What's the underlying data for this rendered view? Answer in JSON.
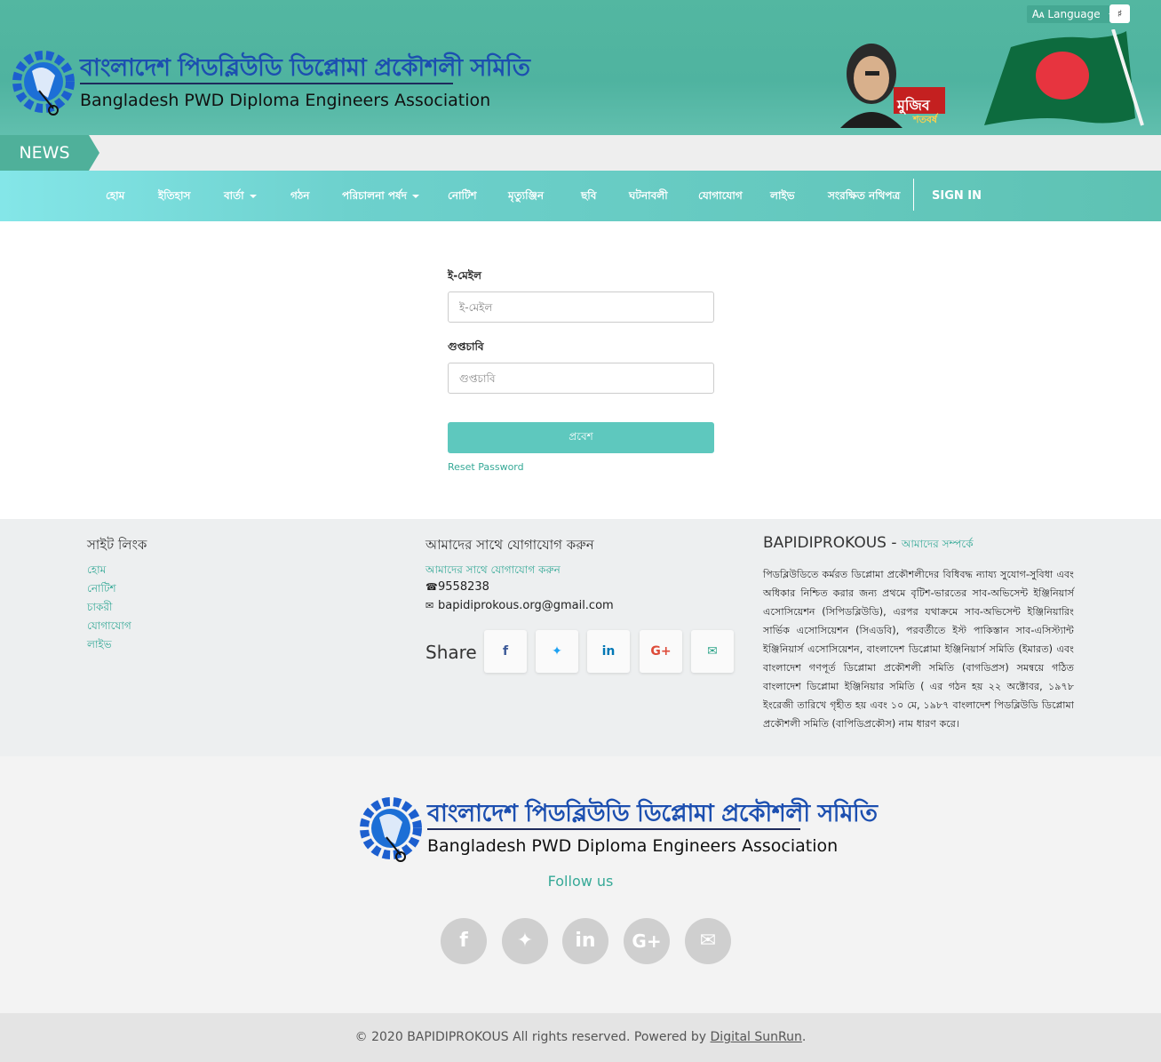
{
  "header": {
    "org_name_bn": "বাংলাদেশ পিডব্লিউডি ডিপ্লোমা প্রকৌশলী সমিতি",
    "org_name_en": "Bangladesh PWD Diploma Engineers Association",
    "language_label": "Language",
    "mujib_text": "মুজিব",
    "mujib_year": "শতবর্ষ"
  },
  "news": {
    "label": "NEWS"
  },
  "nav": {
    "items": [
      {
        "label": "হোম"
      },
      {
        "label": "ইতিহাস"
      },
      {
        "label": "বার্তা"
      },
      {
        "label": "গঠন"
      },
      {
        "label": "পরিচালনা পর্ষদ"
      },
      {
        "label": "নোটিশ"
      },
      {
        "label": "মৃত্যুঞ্জিন"
      },
      {
        "label": "ছবি"
      },
      {
        "label": "ঘটনাবলী"
      },
      {
        "label": "যোগাযোগ"
      },
      {
        "label": "লাইভ"
      },
      {
        "label": "সংরক্ষিত নথিপত্র"
      }
    ],
    "sign_in": "SIGN IN"
  },
  "login": {
    "email_label": "ই-মেইল",
    "email_placeholder": "ই-মেইল",
    "password_label": "গুপ্তচাবি",
    "password_placeholder": "গুপ্তচাবি",
    "submit_label": "প্রবেশ",
    "reset_label": "Reset Password"
  },
  "footer": {
    "site_links_title": "সাইট লিংক",
    "site_links": [
      "হোম",
      "নোটিশ",
      "চাকরী",
      "যোগাযোগ",
      "লাইভ"
    ],
    "contact_title": "আমাদের সাথে যোগাযোগ করুন",
    "contact_link": "আমাদের সাথে যোগাযোগ করুন",
    "phone": "9558238",
    "email": "bapidiprokous.org@gmail.com",
    "share_label": "Share",
    "about_title": "BAPIDIPROKOUS",
    "about_sep": " - ",
    "about_sub": "আমাদের সম্পর্কে",
    "about_body": "পিডব্লিউডিতে কর্মরত ডিপ্লোমা প্রকৌশলীদের বিধিবদ্ধ ন্যায্য সুযোগ-সুবিধা এবং অধিকার নিশ্চিত করার জন্য প্রথমে বৃটিশ-ভারতের সাব-অভিসেন্ট ইঞ্জিনিয়ার্স এসোসিয়েশন (সিপিডব্লিউডি), এরপর যথাক্রমে সাব-অভিসেন্ট ইঞ্জিনিয়ারিং সার্ভিক এসোসিয়েশন (সিএডবি), পরবর্তীতে ইস্ট পাকিস্তান সাব-এসিস্ট্যান্ট ইঞ্জিনিয়ার্স এসোসিয়েশন, বাংলাদেশ ডিপ্লোমা ইঞ্জিনিয়ার্স সমিতি (ইমারত) এবং বাংলাদেশ গণপূর্ত ডিপ্লোমা প্রকৌশলী সমিতি (বাগডিপ্রস) সমন্বয়ে গঠিত বাংলাদেশ ডিপ্লোমা ইঞ্জিনিয়ার সমিতি ( এর গঠন হয় ২২ অক্টোবর, ১৯৭৮ ইংরেজী তারিখে গৃহীত হয় এবং ১০ মে, ১৯৮৭ বাংলাদেশ পিডব্লিউডি ডিপ্লোমা প্রকৌশলী সমিতি (বাপিডিপ্রকৌস) নাম ধারণ করে।",
    "bottom_org_bn": "বাংলাদেশ পিডব্লিউডি ডিপ্লোমা প্রকৌশলী সমিতি",
    "bottom_org_en": "Bangladesh PWD Diploma Engineers Association",
    "follow_us": "Follow us",
    "copyright_prefix": "© 2020 BAPIDIPROKOUS All rights reserved. Powered by ",
    "copyright_link": "Digital SunRun",
    "copyright_suffix": "."
  },
  "colors": {
    "brand_teal": "#4fb3a0",
    "accent_link": "#36a997",
    "logo_blue": "#1c4fb0",
    "button": "#5ec8be"
  },
  "icons": {
    "share": [
      "facebook-icon",
      "twitter-icon",
      "linkedin-icon",
      "google-plus-icon",
      "envelope-icon"
    ],
    "social": [
      "facebook-icon",
      "twitter-icon",
      "linkedin-icon",
      "google-plus-icon",
      "envelope-icon"
    ]
  }
}
